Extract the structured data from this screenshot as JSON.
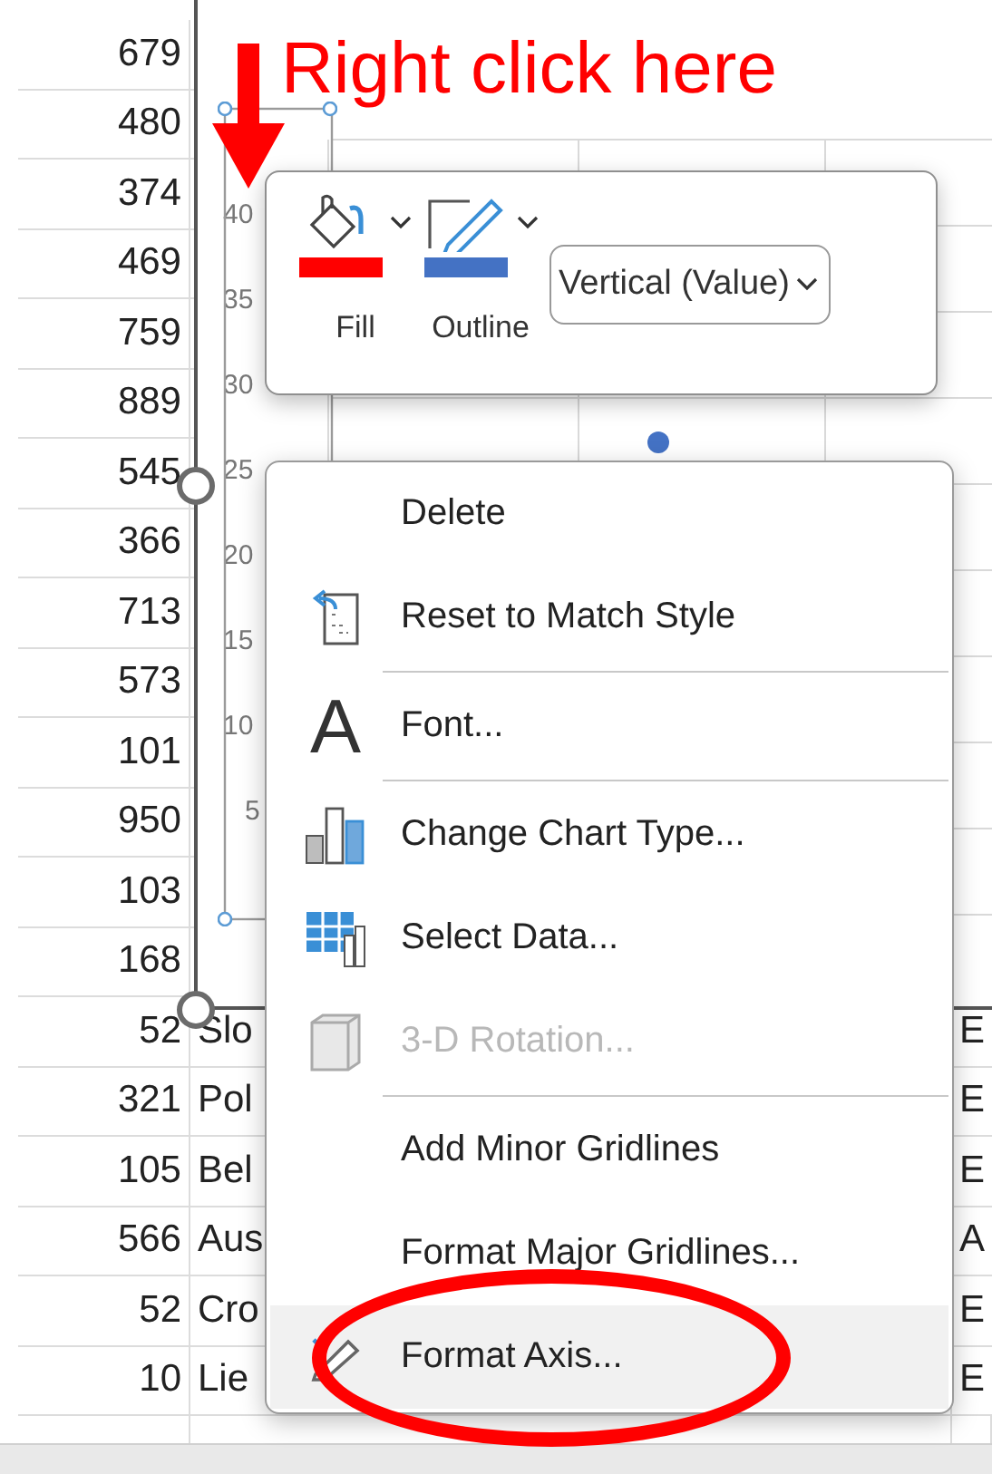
{
  "sheet": {
    "rows": [
      {
        "col_a": "679"
      },
      {
        "col_a": "480"
      },
      {
        "col_a": "374"
      },
      {
        "col_a": "469"
      },
      {
        "col_a": "759"
      },
      {
        "col_a": "889"
      },
      {
        "col_a": "545"
      },
      {
        "col_a": "366"
      },
      {
        "col_a": "713"
      },
      {
        "col_a": "573"
      },
      {
        "col_a": "101"
      },
      {
        "col_a": "950"
      },
      {
        "col_a": "103"
      },
      {
        "col_a": "168"
      },
      {
        "col_a": "52",
        "col_b": "Slo",
        "col_c": "E"
      },
      {
        "col_a": "321",
        "col_b": "Pol",
        "col_c": "E"
      },
      {
        "col_a": "105",
        "col_b": "Bel",
        "col_c": "E"
      },
      {
        "col_a": "566",
        "col_b": "Aus",
        "col_c": "A"
      },
      {
        "col_a": "52",
        "col_b": "Cro",
        "col_c": "E"
      },
      {
        "col_a": "10",
        "col_b": "Lie",
        "col_c": "E"
      }
    ]
  },
  "chart": {
    "axis_labels": [
      "40",
      "35",
      "30",
      "25",
      "20",
      "15",
      "10",
      "5"
    ]
  },
  "mini_toolbar": {
    "tools": [
      {
        "kind": "fill",
        "label": "Fill",
        "color": "#ff0000"
      },
      {
        "kind": "outline",
        "label": "Outline",
        "color": "#4472c4"
      }
    ],
    "element_dropdown": {
      "value": "Vertical (Value)"
    }
  },
  "menu": {
    "items": [
      {
        "kind": "delete",
        "label": "Delete",
        "disabled": false,
        "selected": false,
        "divider_after": false
      },
      {
        "kind": "reset",
        "label": "Reset to Match Style",
        "disabled": false,
        "selected": false,
        "divider_after": true
      },
      {
        "kind": "font",
        "icon_text": "A",
        "label": "Font...",
        "disabled": false,
        "selected": false,
        "divider_after": true
      },
      {
        "kind": "chart_type",
        "label": "Change Chart Type...",
        "disabled": false,
        "selected": false,
        "divider_after": false
      },
      {
        "kind": "select_data",
        "label": "Select Data...",
        "disabled": false,
        "selected": false,
        "divider_after": false
      },
      {
        "kind": "rotation",
        "label": "3-D Rotation...",
        "disabled": true,
        "selected": false,
        "divider_after": true
      },
      {
        "kind": "gridlines",
        "label": "Add Minor Gridlines",
        "disabled": false,
        "selected": false,
        "divider_after": false
      },
      {
        "kind": "gridlines",
        "label": "Format Major Gridlines...",
        "disabled": false,
        "selected": false,
        "divider_after": false
      },
      {
        "kind": "format_axis",
        "label": "Format Axis...",
        "disabled": false,
        "selected": true,
        "divider_after": false
      }
    ]
  },
  "annotation": {
    "text": "Right click here"
  }
}
